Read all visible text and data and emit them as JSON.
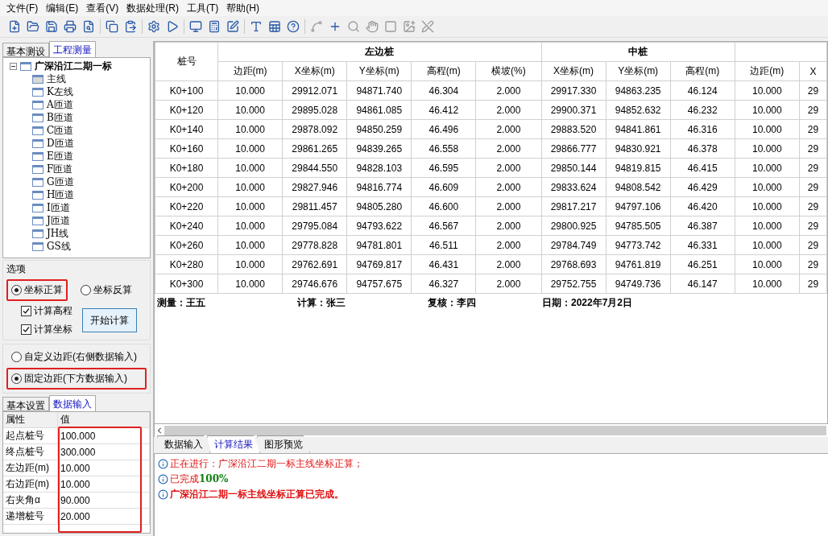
{
  "menu": [
    "文件(F)",
    "编辑(E)",
    "查看(V)",
    "数据处理(R)",
    "工具(T)",
    "帮助(H)"
  ],
  "toolbar": [
    [
      {
        "disabled": false
      },
      {
        "disabled": false
      },
      {
        "disabled": false
      },
      {
        "disabled": false
      },
      {
        "disabled": false
      }
    ],
    [
      {
        "disabled": false
      },
      {
        "disabled": false
      }
    ],
    [
      {
        "disabled": false
      },
      {
        "disabled": false
      }
    ],
    [
      {
        "disabled": false
      },
      {
        "disabled": false
      },
      {
        "disabled": false
      }
    ],
    [
      {
        "disabled": false
      },
      {
        "disabled": false
      },
      {
        "disabled": false
      }
    ],
    [
      {
        "disabled": true
      },
      {
        "disabled": false
      },
      {
        "disabled": true
      },
      {
        "disabled": true
      },
      {
        "disabled": true
      },
      {
        "disabled": true
      },
      {
        "disabled": true
      }
    ]
  ],
  "left_tabs": [
    {
      "label": "基本测设",
      "selected": false
    },
    {
      "label": "工程测量",
      "selected": true
    }
  ],
  "tree": {
    "label": "广深沿江二期一标",
    "expanded": true,
    "children": [
      {
        "label": "主线",
        "selected": true
      },
      {
        "label": "K左线",
        "selected": false
      },
      {
        "label": "A匝道",
        "selected": false
      },
      {
        "label": "B匝道",
        "selected": false
      },
      {
        "label": "C匝道",
        "selected": false
      },
      {
        "label": "D匝道",
        "selected": false
      },
      {
        "label": "E匝道",
        "selected": false
      },
      {
        "label": "F匝道",
        "selected": false
      },
      {
        "label": "G匝道",
        "selected": false
      },
      {
        "label": "H匝道",
        "selected": false
      },
      {
        "label": "I匝道",
        "selected": false
      },
      {
        "label": "J匝道",
        "selected": false
      },
      {
        "label": "JH线",
        "selected": false
      },
      {
        "label": "GS线",
        "selected": false
      }
    ]
  },
  "options": {
    "title": "选项",
    "modes": [
      {
        "label": "坐标正算",
        "selected": true,
        "highlighted": true
      },
      {
        "label": "坐标反算",
        "selected": false,
        "highlighted": false
      }
    ],
    "checks": [
      {
        "label": "计算高程",
        "checked": true
      },
      {
        "label": "计算坐标",
        "checked": true
      }
    ],
    "button": "开始计算",
    "offsets": [
      {
        "label": "自定义边距(右侧数据输入)",
        "selected": false,
        "highlighted": false
      },
      {
        "label": "固定边距(下方数据输入)",
        "selected": true,
        "highlighted": true
      }
    ]
  },
  "input_tabs": [
    {
      "label": "基本设置",
      "selected": false
    },
    {
      "label": "数据输入",
      "selected": true
    }
  ],
  "properties": {
    "columns": [
      "属性",
      "值"
    ],
    "values_highlighted": true,
    "rows": [
      {
        "name": "起点桩号",
        "value": "100.000"
      },
      {
        "name": "终点桩号",
        "value": "300.000"
      },
      {
        "name": "左边距(m)",
        "value": "10.000"
      },
      {
        "name": "右边距(m)",
        "value": "10.000"
      },
      {
        "name": "右夹角α",
        "value": "90.000"
      },
      {
        "name": "递增桩号",
        "value": "20.000"
      }
    ]
  },
  "table": {
    "station_header": "桩号",
    "groups": [
      {
        "label": "左边桩",
        "columns": [
          "边距(m)",
          "X坐标(m)",
          "Y坐标(m)",
          "高程(m)",
          "横坡(%)"
        ]
      },
      {
        "label": "中桩",
        "columns": [
          "X坐标(m)",
          "Y坐标(m)",
          "高程(m)"
        ]
      },
      {
        "columns": [
          "边距(m)",
          "X"
        ]
      }
    ],
    "rows": [
      {
        "station": "K0+100",
        "cells": [
          "10.000",
          "29912.071",
          "94871.740",
          "46.304",
          "2.000",
          "29917.330",
          "94863.235",
          "46.124",
          "10.000",
          "29"
        ]
      },
      {
        "station": "K0+120",
        "cells": [
          "10.000",
          "29895.028",
          "94861.085",
          "46.412",
          "2.000",
          "29900.371",
          "94852.632",
          "46.232",
          "10.000",
          "29"
        ]
      },
      {
        "station": "K0+140",
        "cells": [
          "10.000",
          "29878.092",
          "94850.259",
          "46.496",
          "2.000",
          "29883.520",
          "94841.861",
          "46.316",
          "10.000",
          "29"
        ]
      },
      {
        "station": "K0+160",
        "cells": [
          "10.000",
          "29861.265",
          "94839.265",
          "46.558",
          "2.000",
          "29866.777",
          "94830.921",
          "46.378",
          "10.000",
          "29"
        ]
      },
      {
        "station": "K0+180",
        "cells": [
          "10.000",
          "29844.550",
          "94828.103",
          "46.595",
          "2.000",
          "29850.144",
          "94819.815",
          "46.415",
          "10.000",
          "29"
        ]
      },
      {
        "station": "K0+200",
        "cells": [
          "10.000",
          "29827.946",
          "94816.774",
          "46.609",
          "2.000",
          "29833.624",
          "94808.542",
          "46.429",
          "10.000",
          "29"
        ]
      },
      {
        "station": "K0+220",
        "cells": [
          "10.000",
          "29811.457",
          "94805.280",
          "46.600",
          "2.000",
          "29817.217",
          "94797.106",
          "46.420",
          "10.000",
          "29"
        ]
      },
      {
        "station": "K0+240",
        "cells": [
          "10.000",
          "29795.084",
          "94793.622",
          "46.567",
          "2.000",
          "29800.925",
          "94785.505",
          "46.387",
          "10.000",
          "29"
        ]
      },
      {
        "station": "K0+260",
        "cells": [
          "10.000",
          "29778.828",
          "94781.801",
          "46.511",
          "2.000",
          "29784.749",
          "94773.742",
          "46.331",
          "10.000",
          "29"
        ]
      },
      {
        "station": "K0+280",
        "cells": [
          "10.000",
          "29762.691",
          "94769.817",
          "46.431",
          "2.000",
          "29768.693",
          "94761.819",
          "46.251",
          "10.000",
          "29"
        ]
      },
      {
        "station": "K0+300",
        "cells": [
          "10.000",
          "29746.676",
          "94757.675",
          "46.327",
          "2.000",
          "29752.755",
          "94749.736",
          "46.147",
          "10.000",
          "29"
        ]
      }
    ],
    "footer": [
      "测量：王五",
      "计算：张三",
      "复核：李四",
      "日期：2022年7月2日"
    ]
  },
  "bottom_tabs": [
    {
      "label": "数据输入",
      "selected": false
    },
    {
      "label": "计算结果",
      "selected": true
    },
    {
      "label": "图形预览",
      "selected": false
    }
  ],
  "log": [
    {
      "text": "正在进行：广深沿江二期一标主线坐标正算；",
      "bold": false
    },
    {
      "text": "已完成",
      "value": "100%",
      "bold": false
    },
    {
      "text": "广深沿江二期一标主线坐标正算已完成。",
      "bold": true
    }
  ]
}
